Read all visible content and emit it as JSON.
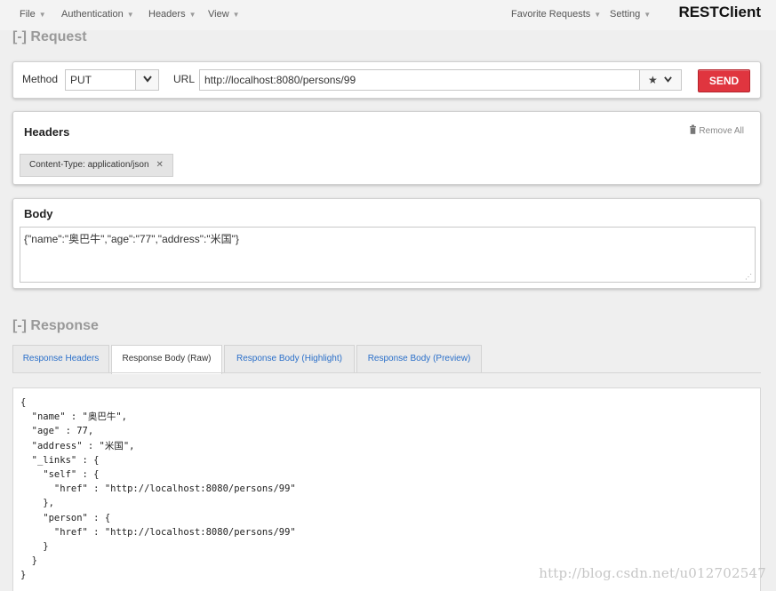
{
  "nav": {
    "file": "File",
    "authentication": "Authentication",
    "headers": "Headers",
    "view": "View",
    "favorite_requests": "Favorite Requests",
    "setting": "Setting",
    "brand": "RESTClient"
  },
  "request": {
    "section_title": "[-] Request",
    "method_label": "Method",
    "method_value": "PUT",
    "url_label": "URL",
    "url_value": "http://localhost:8080/persons/99",
    "send_label": "SEND"
  },
  "headers_panel": {
    "title": "Headers",
    "remove_all": "Remove All",
    "chips": [
      "Content-Type: application/json"
    ]
  },
  "body_panel": {
    "title": "Body",
    "value": "{\"name\":\"奥巴牛\",\"age\":\"77\",\"address\":\"米国\"}"
  },
  "response": {
    "section_title": "[-] Response",
    "tabs": [
      "Response Headers",
      "Response Body (Raw)",
      "Response Body (Highlight)",
      "Response Body (Preview)"
    ],
    "active_tab": "Response Body (Raw)",
    "raw_body": "{\n  \"name\" : \"奥巴牛\",\n  \"age\" : 77,\n  \"address\" : \"米国\",\n  \"_links\" : {\n    \"self\" : {\n      \"href\" : \"http://localhost:8080/persons/99\"\n    },\n    \"person\" : {\n      \"href\" : \"http://localhost:8080/persons/99\"\n    }\n  }\n}"
  },
  "watermark": "http://blog.csdn.net/u012702547",
  "icons": {
    "dropdown": "chevron-down-icon",
    "favorite": "star-icon",
    "trash": "trash-icon",
    "remove_chip": "close-icon"
  },
  "colors": {
    "send": "#e0353f",
    "tab_link": "#2a6fc9",
    "section_title": "#999999"
  }
}
